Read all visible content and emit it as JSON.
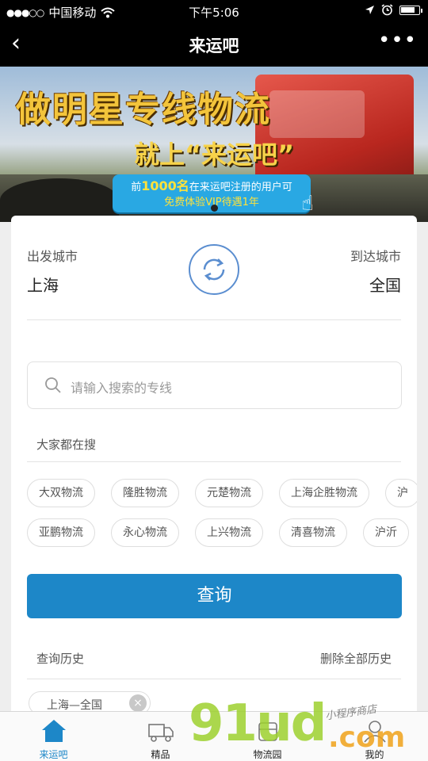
{
  "status_bar": {
    "signal": "●●●○○",
    "carrier": "中国移动",
    "wifi_icon": "wifi-icon",
    "time": "下午5:06",
    "location_icon": "location-arrow-icon",
    "alarm_icon": "alarm-icon",
    "battery_level": 0.8
  },
  "nav": {
    "back_glyph": "‹",
    "title": "来运吧",
    "more_glyph": "•••"
  },
  "banner": {
    "headline": "做明星专线物流",
    "subline": "就上“来运吧”",
    "promo_prefix": "前",
    "promo_highlight": "1000名",
    "promo_rest": "在来运吧注册的用户可",
    "promo_line2": "免费体验VIP待遇1年",
    "carousel_dots": 1
  },
  "route": {
    "from_label": "出发城市",
    "from_city": "上海",
    "to_label": "到达城市",
    "to_city": "全国",
    "swap_icon": "swap-cities-icon"
  },
  "search": {
    "placeholder": "请输入搜索的专线"
  },
  "popular": {
    "label": "大家都在搜",
    "row1": [
      "大双物流",
      "隆胜物流",
      "元楚物流",
      "上海企胜物流",
      "沪"
    ],
    "row2": [
      "亚鹏物流",
      "永心物流",
      "上兴物流",
      "清喜物流",
      "沪沂"
    ]
  },
  "query_button": "查询",
  "history": {
    "label": "查询历史",
    "clear_all": "删除全部历史",
    "items": [
      "上海—全国"
    ],
    "remove_glyph": "×"
  },
  "tabbar": {
    "tabs": [
      {
        "label": "来运吧",
        "icon": "home-icon",
        "active": true
      },
      {
        "label": "精品",
        "icon": "truck-icon",
        "active": false
      },
      {
        "label": "物流园",
        "icon": "logistics-park-icon",
        "active": false
      },
      {
        "label": "我的",
        "icon": "profile-icon",
        "active": false
      }
    ]
  },
  "watermark": {
    "main": "91ud",
    "suffix": ".com",
    "tagline": "小程序商店"
  },
  "colors": {
    "accent": "#1d87c8",
    "banner_promo": "#29a8e3",
    "headline_gold": "#f3c43b",
    "swap_ring": "#5b8ed0"
  }
}
